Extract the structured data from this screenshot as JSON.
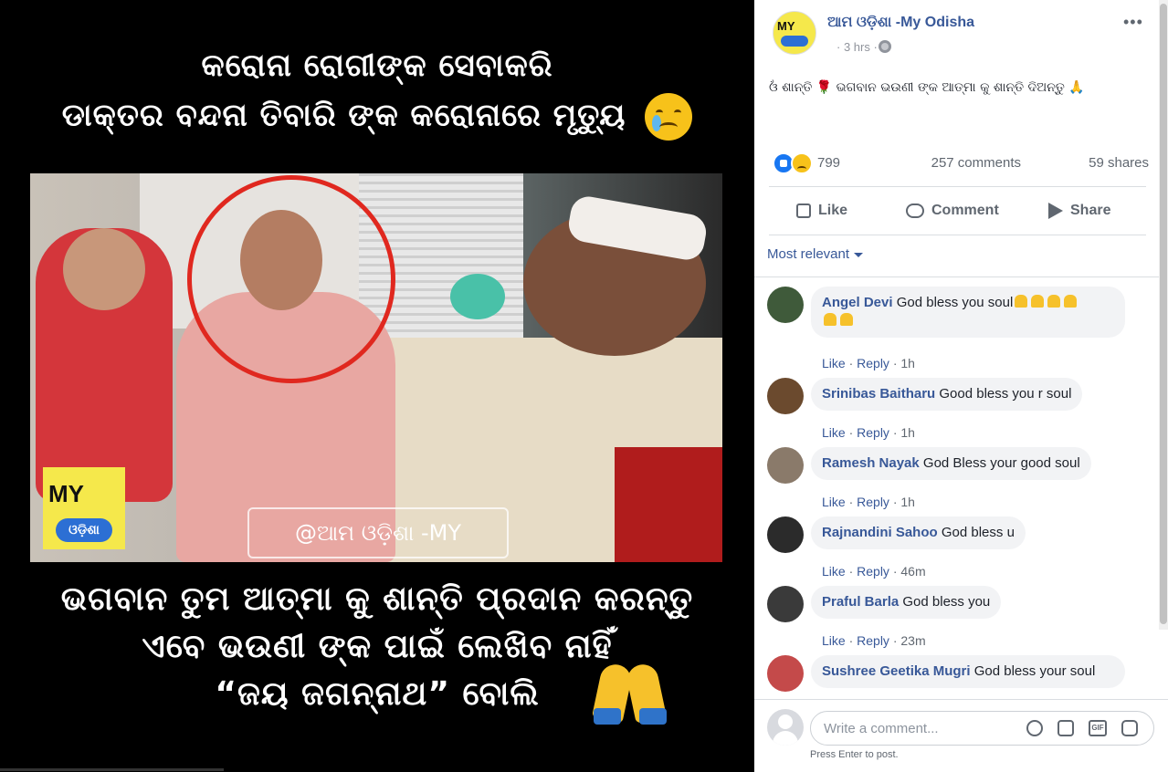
{
  "photo": {
    "title_line1": "କରୋନା ରୋଗୀଙ୍କ ସେବାକରି",
    "title_line2": "ଡାକ୍ତର ବନ୍ଦନା ତିବାରି ଙ୍କ କରୋନାରେ ମୃତ୍ୟୁ",
    "logo_text_top": "MY",
    "logo_text_bottom": "ଓଡ଼ିଶା",
    "watermark": "@ଆମ ଓଡ଼ିଶା -MY ODISHA",
    "caption_line1": "ଭଗବାନ ତୁମ ଆତ୍ମା କୁ ଶାନ୍ତି ପ୍ରଦାନ କରନ୍ତୁ",
    "caption_line2": "ଏବେ ଭଉଣୀ ଙ୍କ ପାଇଁ ଲେଖିବ ନାହିଁ",
    "caption_line3": "“ଜୟ ଜଗନ୍ନାଥ” ବୋଲି",
    "title_emoji": "crying-face-icon",
    "caption_emoji": "folded-hands-icon"
  },
  "post": {
    "page_name": "ଆମ ଓଡ଼ିଶା -My Odisha",
    "time": "· 3 hrs ·",
    "text": "ଓଁ ଶାନ୍ତି 🌹 ଭଗବାନ ଭଉଣୀ ଙ୍କ ଆତ୍ମା କୁ ଶାନ୍ତି ଦିଅନ୍ତୁ 🙏",
    "more": "•••",
    "reaction_count": "799",
    "comment_count": "257 comments",
    "share_count": "59 shares",
    "actions": {
      "like": "Like",
      "comment": "Comment",
      "share": "Share"
    },
    "sort_label": "Most relevant"
  },
  "comments": [
    {
      "author": "Angel Devi",
      "text": "God bless you soul",
      "pray_count": 6,
      "like": "Like",
      "reply": "Reply",
      "time": "· 1h",
      "avatar_color": "#3f5a3a"
    },
    {
      "author": "Srinibas Baitharu",
      "text": "Good bless you r soul",
      "like": "Like",
      "reply": "Reply",
      "time": "· 1h",
      "avatar_color": "#6b4a2e"
    },
    {
      "author": "Ramesh Nayak",
      "text": "God Bless your good soul",
      "like": "Like",
      "reply": "Reply",
      "time": "· 1h",
      "avatar_color": "#8a7a6a"
    },
    {
      "author": "Rajnandini Sahoo",
      "text": "God bless u",
      "like": "Like",
      "reply": "Reply",
      "time": "· 46m",
      "avatar_color": "#2b2b2b"
    },
    {
      "author": "Praful Barla",
      "text": "God bless you",
      "like": "Like",
      "reply": "Reply",
      "time": "· 23m",
      "avatar_color": "#3a3a3a"
    },
    {
      "author": "Sushree Geetika Mugri",
      "text": "God bless your soul",
      "avatar_color": "#c44a4a"
    }
  ],
  "compose": {
    "placeholder": "Write a comment...",
    "hint": "Press Enter to post.",
    "gif_label": "GIF"
  },
  "colors": {
    "link": "#385898",
    "meta": "#606770",
    "bubble": "#f2f3f5",
    "brand_yellow": "#f5e84b",
    "highlight_red": "#e0281f"
  }
}
